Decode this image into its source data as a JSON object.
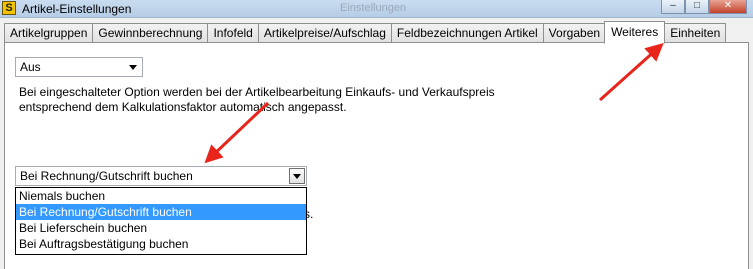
{
  "window": {
    "title": "Artikel-Einstellungen",
    "icon_letter": "S",
    "ghost_title": "Einstellungen",
    "buttons": {
      "minimize": "–",
      "maximize": "□",
      "close": "✕"
    }
  },
  "tabs": [
    {
      "label": "Artikelgruppen"
    },
    {
      "label": "Gewinnberechnung"
    },
    {
      "label": "Infofeld"
    },
    {
      "label": "Artikelpreise/Aufschlag"
    },
    {
      "label": "Feldbezeichnungen Artikel"
    },
    {
      "label": "Vorgaben"
    },
    {
      "label": "Weiteres"
    },
    {
      "label": "Einheiten"
    }
  ],
  "active_tab": "Weiteres",
  "auto_price": {
    "selected": "Aus",
    "description": "Bei eingeschalteter Option werden bei der Artikelbearbeitung Einkaufs- und Verkaufspreis entsprechend dem Kalkulationsfaktor automatisch angepasst."
  },
  "booking": {
    "selected": "Bei Rechnung/Gutschrift buchen",
    "options": [
      "Niemals buchen",
      "Bei Rechnung/Gutschrift buchen",
      "Bei Lieferschein buchen",
      "Bei Auftragsbestätigung buchen"
    ],
    "hidden_text_fragments": [
      ".",
      "s."
    ]
  },
  "annotations": {
    "arrow_color": "#e8241b",
    "count": 2
  },
  "colors": {
    "selection": "#3399ff",
    "titlebar": "#c9dcf0"
  }
}
